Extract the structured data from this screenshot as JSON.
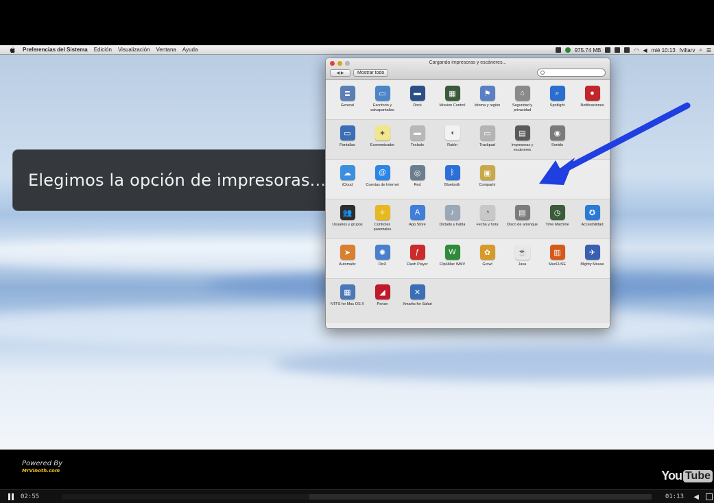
{
  "menubar": {
    "app": "Preferencias del Sistema",
    "menus": [
      "Edición",
      "Visualización",
      "Ventana",
      "Ayuda"
    ],
    "memory": "975.74 MB",
    "clock": "mié 10:13",
    "user": "fvillarv"
  },
  "caption": "Elegimos la opción de impresoras...",
  "window": {
    "title": "Cargando impresoras y escáneres...",
    "show_all": "Mostrar todo",
    "nav": "◀ ▶",
    "sections": [
      [
        {
          "label": "General",
          "color": "#5b7fb5",
          "glyph": "≣"
        },
        {
          "label": "Escritorio y salvapantallas",
          "color": "#4d86c8",
          "glyph": "▭"
        },
        {
          "label": "Dock",
          "color": "#2c4e86",
          "glyph": "▬"
        },
        {
          "label": "Mission Control",
          "color": "#3a5a3a",
          "glyph": "▦"
        },
        {
          "label": "Idioma y región",
          "color": "#5a7fc4",
          "glyph": "⚑"
        },
        {
          "label": "Seguridad y privacidad",
          "color": "#8a8a8a",
          "glyph": "⌂"
        },
        {
          "label": "Spotlight",
          "color": "#2a6fd0",
          "glyph": "⌕"
        },
        {
          "label": "Notificaciones",
          "color": "#c0262a",
          "glyph": "●"
        }
      ],
      [
        {
          "label": "Pantallas",
          "color": "#3b6fb5",
          "glyph": "▭"
        },
        {
          "label": "Economizador",
          "color": "#f0e68c",
          "glyph": "✦"
        },
        {
          "label": "Teclado",
          "color": "#b8b8b8",
          "glyph": "▬"
        },
        {
          "label": "Ratón",
          "color": "#f2f2f2",
          "glyph": "◖"
        },
        {
          "label": "Trackpad",
          "color": "#b4b4b4",
          "glyph": "▭"
        },
        {
          "label": "Impresoras y escáneres",
          "color": "#5a5a5a",
          "glyph": "▤"
        },
        {
          "label": "Sonido",
          "color": "#7a7a7a",
          "glyph": "◉"
        }
      ],
      [
        {
          "label": "iCloud",
          "color": "#3a8fe0",
          "glyph": "☁"
        },
        {
          "label": "Cuentas de Internet",
          "color": "#2b86e8",
          "glyph": "@"
        },
        {
          "label": "Red",
          "color": "#6c7d90",
          "glyph": "◎"
        },
        {
          "label": "Bluetooth",
          "color": "#2b6fd9",
          "glyph": "ᛒ"
        },
        {
          "label": "Compartir",
          "color": "#c7a84a",
          "glyph": "▣"
        }
      ],
      [
        {
          "label": "Usuarios y grupos",
          "color": "#2d2d2d",
          "glyph": "👥"
        },
        {
          "label": "Controles parentales",
          "color": "#e7b820",
          "glyph": "✧"
        },
        {
          "label": "App Store",
          "color": "#3f7fd8",
          "glyph": "A"
        },
        {
          "label": "Dictado y habla",
          "color": "#9aa8b8",
          "glyph": "♪"
        },
        {
          "label": "Fecha y hora",
          "color": "#c8c8c8",
          "glyph": "◔"
        },
        {
          "label": "Disco de arranque",
          "color": "#7c7c7c",
          "glyph": "▤"
        },
        {
          "label": "Time Machine",
          "color": "#3b5b3b",
          "glyph": "◷"
        },
        {
          "label": "Accesibilidad",
          "color": "#2b7ad8",
          "glyph": "✪"
        }
      ],
      [
        {
          "label": "Automatic",
          "color": "#d88030",
          "glyph": "➤"
        },
        {
          "label": "DivX",
          "color": "#4a7fcc",
          "glyph": "✺"
        },
        {
          "label": "Flash Player",
          "color": "#cc2b2b",
          "glyph": "ƒ"
        },
        {
          "label": "Flip4Mac WMV",
          "color": "#2f8a3a",
          "glyph": "W"
        },
        {
          "label": "Growl",
          "color": "#d59a2a",
          "glyph": "✿"
        },
        {
          "label": "Java",
          "color": "#e8e8e8",
          "glyph": "☕"
        },
        {
          "label": "MacFUSE",
          "color": "#d45a1a",
          "glyph": "▥"
        },
        {
          "label": "Mighty Mouse",
          "color": "#3a5fb0",
          "glyph": "✈"
        }
      ],
      [
        {
          "label": "NTFS for Mac OS X",
          "color": "#4a78b8",
          "glyph": "▦"
        },
        {
          "label": "Perian",
          "color": "#c01a2a",
          "glyph": "◢"
        },
        {
          "label": "Xmarks for Safari",
          "color": "#3a6fb5",
          "glyph": "✕"
        }
      ]
    ]
  },
  "player": {
    "powered_by": "Powered By",
    "powered_name": "MrVinoth.com",
    "brand_you": "You",
    "brand_tube": "Tube",
    "elapsed": "02:55",
    "total": "01:13",
    "progress": 0.42
  }
}
